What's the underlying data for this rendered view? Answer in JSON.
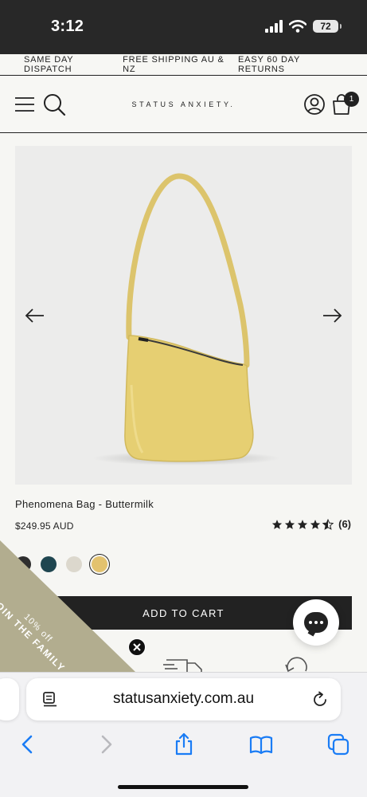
{
  "status_bar": {
    "time": "3:12",
    "battery": "72"
  },
  "announcement": [
    "SAME DAY DISPATCH",
    "FREE SHIPPING AU & NZ",
    "EASY 60 DAY RETURNS"
  ],
  "header": {
    "logo": "STATUS ANXIETY.",
    "cart_count": "1"
  },
  "product": {
    "title": "Phenomena Bag - Buttermilk",
    "price": "$249.95 AUD",
    "rating_value": 4.5,
    "rating_count": "(6)",
    "swatches": [
      "#2e2e2e",
      "#1f4650",
      "#dcd8cd",
      "#e3c26e"
    ],
    "selected_swatch": 3,
    "add_to_cart": "ADD TO CART"
  },
  "promo": {
    "title": "JOIN THE FAMILY",
    "subtitle": "10% off"
  },
  "browser": {
    "url": "statusanxiety.com.au"
  },
  "colors": {
    "dark": "#222222",
    "promo": "#b2ad8f",
    "accent_blue": "#1a7cf5",
    "bag": "#e6cf72"
  },
  "icons": [
    "menu-icon",
    "search-icon",
    "account-icon",
    "cart-icon",
    "arrow-left-icon",
    "arrow-right-icon",
    "star-icon",
    "chat-icon",
    "close-icon",
    "reader-icon",
    "reload-icon",
    "back-icon",
    "forward-icon",
    "share-icon",
    "bookmarks-icon",
    "tabs-icon"
  ]
}
